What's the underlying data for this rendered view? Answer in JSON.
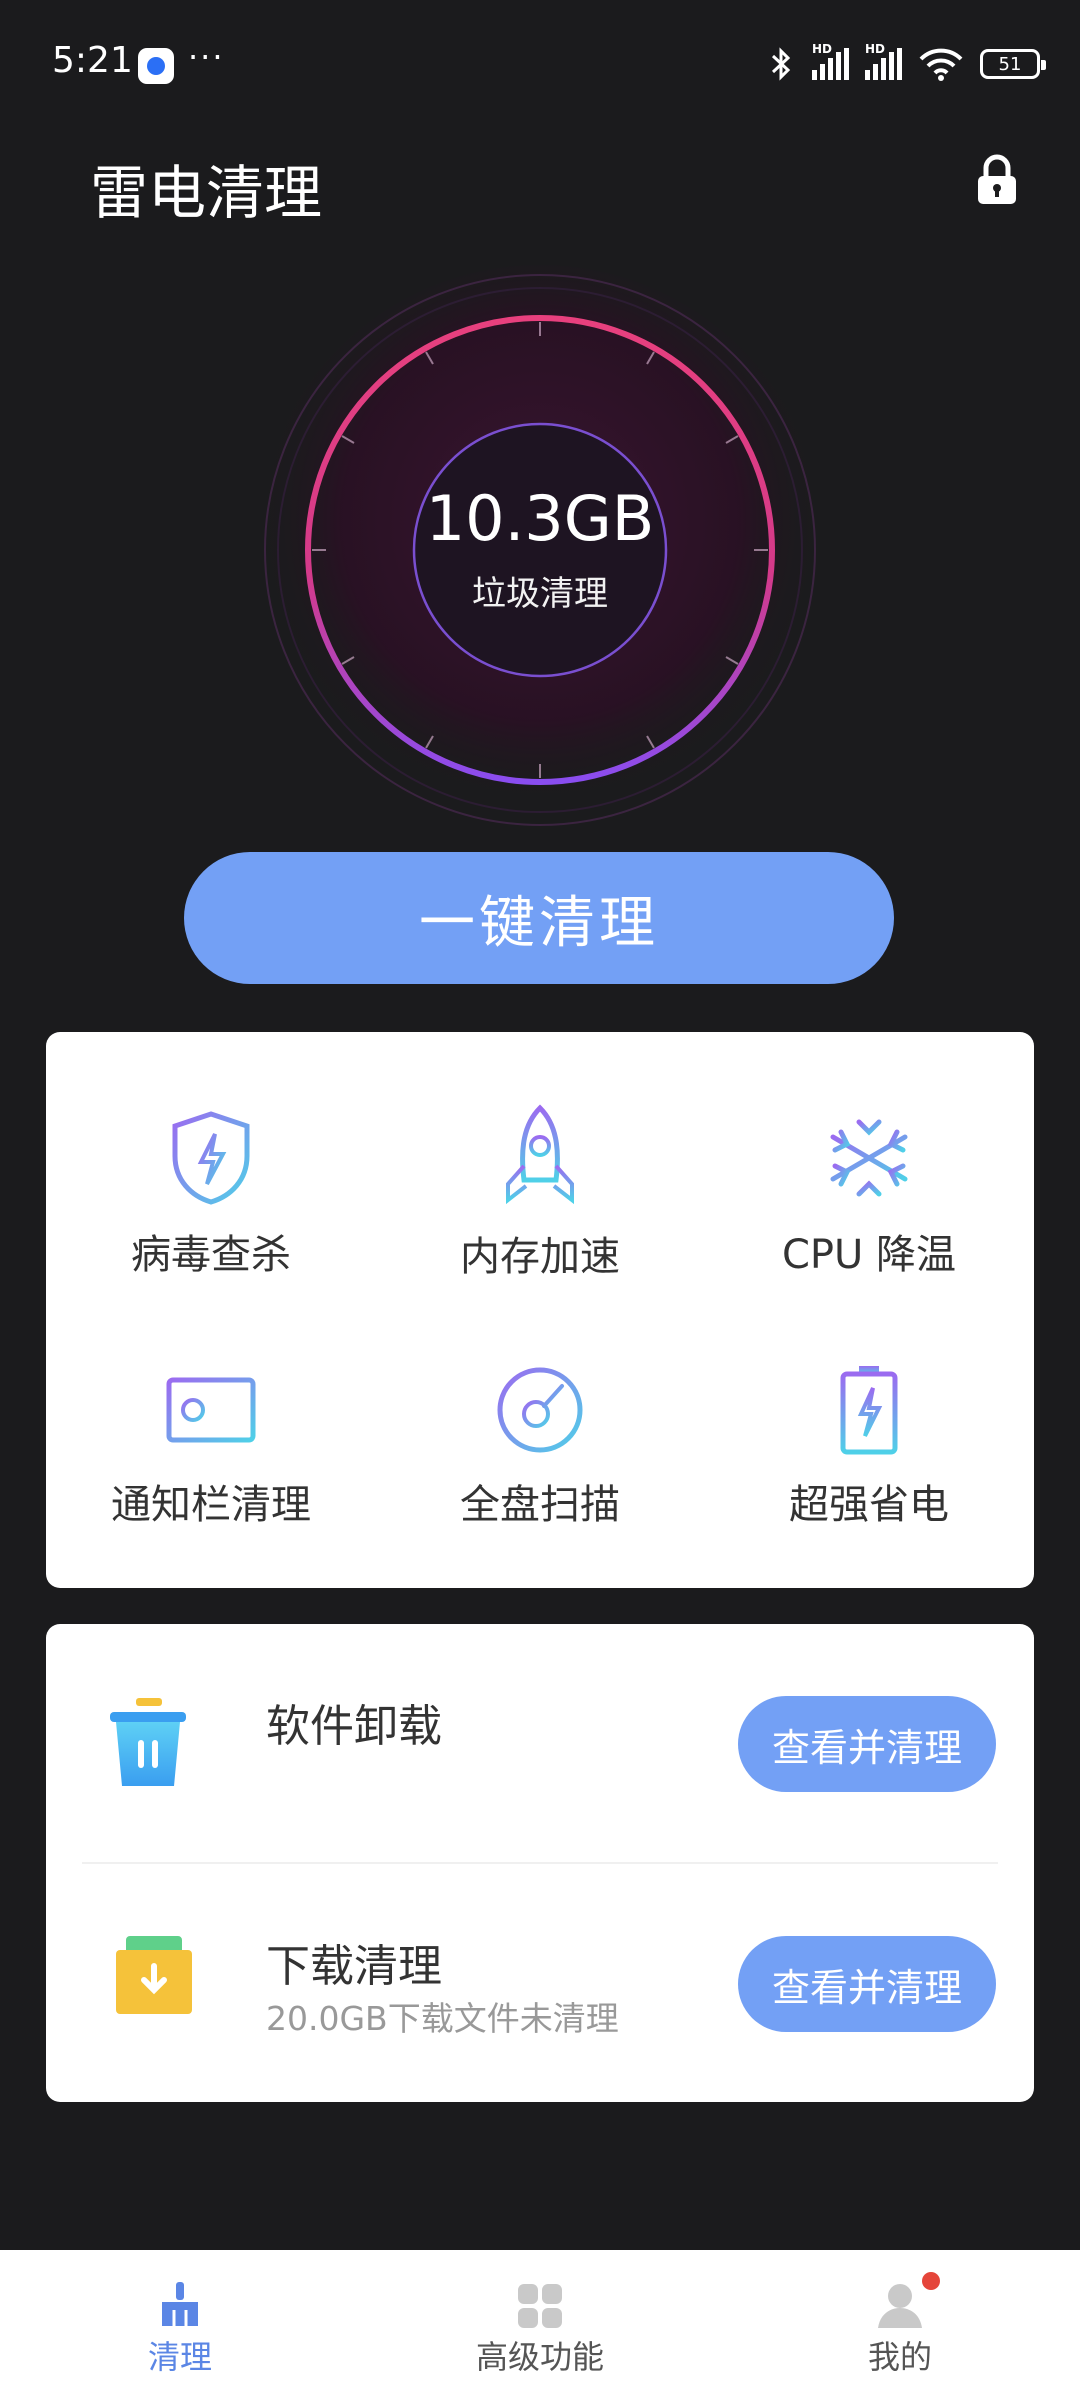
{
  "status_bar": {
    "time": "5:21",
    "more": "···",
    "signal_1_label": "HD",
    "signal_2_label": "HD",
    "battery": "51"
  },
  "header": {
    "title": "雷电清理",
    "lock_icon": "lock-icon"
  },
  "gauge": {
    "value": "10.3GB",
    "label": "垃圾清理"
  },
  "main_button": {
    "label": "一键清理"
  },
  "features": [
    {
      "label": "病毒查杀",
      "icon": "shield-bolt-icon"
    },
    {
      "label": "内存加速",
      "icon": "rocket-icon"
    },
    {
      "label": "CPU 降温",
      "icon": "snowflake-icon"
    },
    {
      "label": "通知栏清理",
      "icon": "notification-card-icon"
    },
    {
      "label": "全盘扫描",
      "icon": "disk-scan-icon"
    },
    {
      "label": "超强省电",
      "icon": "battery-bolt-icon"
    }
  ],
  "actions": [
    {
      "title": "软件卸载",
      "subtitle": "",
      "button": "查看并清理",
      "icon": "trash-bin-icon"
    },
    {
      "title": "下载清理",
      "subtitle": "20.0GB下载文件未清理",
      "button": "查看并清理",
      "icon": "download-box-icon"
    }
  ],
  "bottom_nav": [
    {
      "label": "清理",
      "icon": "broom-icon",
      "active": true
    },
    {
      "label": "高级功能",
      "icon": "grid-icon",
      "active": false
    },
    {
      "label": "我的",
      "icon": "user-icon",
      "active": false,
      "badge": true
    }
  ],
  "colors": {
    "background": "#1b1b1d",
    "accent": "#73a0f5",
    "gauge_pink": "#e8407e",
    "gauge_purple": "#8a4df0"
  }
}
